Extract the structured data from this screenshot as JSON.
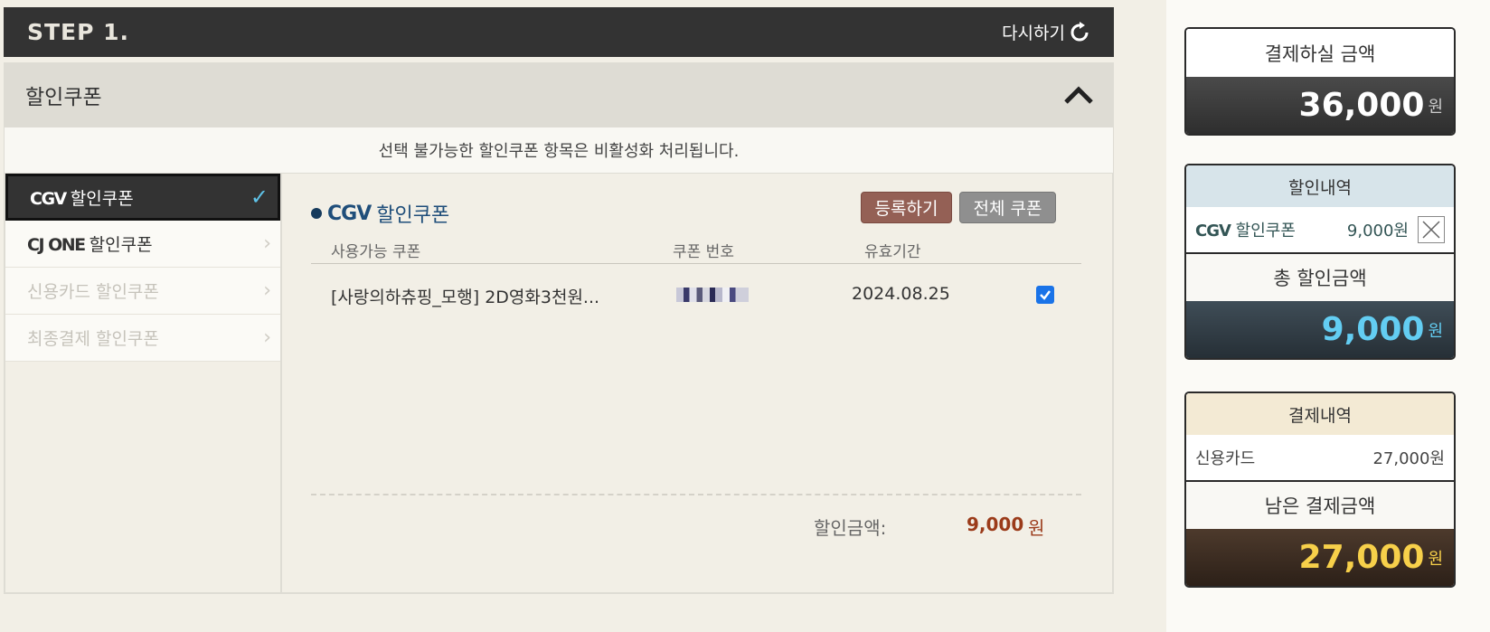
{
  "step": {
    "title": "STEP 1.",
    "reset_label": "다시하기"
  },
  "section": {
    "title": "할인쿠폰"
  },
  "notice": "선택 불가능한 할인쿠폰 항목은 비활성화 처리됩니다.",
  "tabs": [
    {
      "brand": "CGV",
      "label": "할인쿠폰",
      "state": "active"
    },
    {
      "brand": "CJ ONE",
      "label": "할인쿠폰",
      "state": "enabled"
    },
    {
      "brand": "",
      "label": "신용카드 할인쿠폰",
      "state": "disabled"
    },
    {
      "brand": "",
      "label": "최종결제 할인쿠폰",
      "state": "disabled"
    }
  ],
  "coupon_panel": {
    "title_brand": "CGV",
    "title": "할인쿠폰",
    "register_button": "등록하기",
    "all_coupons_button": "전체 쿠폰",
    "columns": {
      "name": "사용가능 쿠폰",
      "number": "쿠폰 번호",
      "expiry": "유효기간"
    },
    "rows": [
      {
        "name": "[사랑의하츄핑_모행] 2D영화3천원...",
        "expiry": "2024.08.25",
        "checked": true
      }
    ],
    "discount_label": "할인금액:",
    "discount_value": "9,000",
    "discount_unit": "원"
  },
  "sidebar": {
    "payment_due": {
      "label": "결제하실 금액",
      "amount": "36,000",
      "unit": "원"
    },
    "discount_detail": {
      "label": "할인내역",
      "item_brand": "CGV",
      "item_label": "할인쿠폰",
      "item_amount": "9,000원",
      "total_label": "총 할인금액",
      "total_amount": "9,000",
      "unit": "원"
    },
    "payment_detail": {
      "label": "결제내역",
      "item_label": "신용카드",
      "item_amount": "27,000원",
      "remaining_label": "남은 결제금액",
      "remaining_amount": "27,000",
      "unit": "원"
    }
  },
  "colors": {
    "header_bg": "#333333",
    "discount_red": "#9b3b1a",
    "blue_amount": "#63cdf2",
    "gold_amount": "#f7d04a",
    "register_btn": "#946055",
    "all_btn": "#8f8f8f"
  },
  "icons": {
    "reset": "refresh-icon",
    "collapse": "chevron-up-icon",
    "check": "checkmark-icon",
    "arrow": "chevron-right-icon",
    "remove": "close-box-icon"
  }
}
